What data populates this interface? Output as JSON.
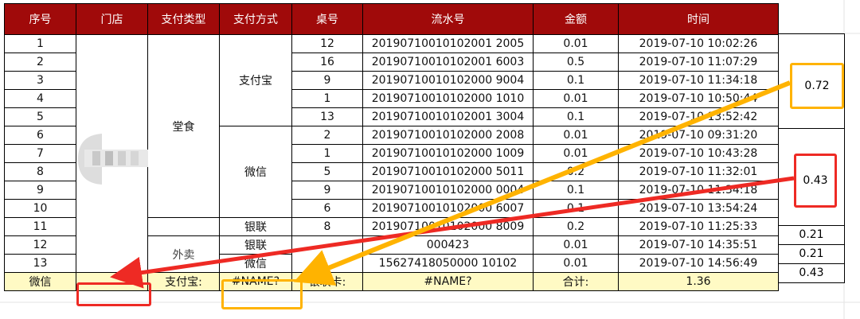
{
  "headers": [
    "序号",
    "门店",
    "支付类型",
    "支付方式",
    "桌号",
    "流水号",
    "金额",
    "时间"
  ],
  "seq": [
    "1",
    "2",
    "3",
    "4",
    "5",
    "6",
    "7",
    "8",
    "9",
    "10",
    "11",
    "12",
    "13"
  ],
  "pay_type": {
    "dine_in": "堂食",
    "takeaway_partial": "外卖"
  },
  "pay_method": {
    "alipay": "支付宝",
    "wechat": "微信",
    "unionpay": "银联",
    "unionpay2": "银联",
    "wechat2": "微信"
  },
  "rows": [
    {
      "table": "12",
      "serial": "20190710010102001 2005",
      "amount": "0.01",
      "time": "2019-07-10 10:02:26"
    },
    {
      "table": "16",
      "serial": "20190710010102001 6003",
      "amount": "0.5",
      "time": "2019-07-10 11:07:29"
    },
    {
      "table": "9",
      "serial": "20190710010102000 9004",
      "amount": "0.1",
      "time": "2019-07-10 11:34:18"
    },
    {
      "table": "1",
      "serial": "20190710010102000 1010",
      "amount": "0.01",
      "time": "2019-07-10 10:50:44"
    },
    {
      "table": "13",
      "serial": "20190710010102001 3004",
      "amount": "0.1",
      "time": "2019-07-10 13:52:42"
    },
    {
      "table": "2",
      "serial": "20190710010102000 2008",
      "amount": "0.01",
      "time": "2019-07-10 09:31:20"
    },
    {
      "table": "1",
      "serial": "20190710010102000 1009",
      "amount": "0.01",
      "time": "2019-07-10 10:43:28"
    },
    {
      "table": "5",
      "serial": "20190710010102000 5011",
      "amount": "0.2",
      "time": "2019-07-10 11:32:01"
    },
    {
      "table": "9",
      "serial": "20190710010102000 0004",
      "amount": "0.1",
      "time": "2019-07-10 11:34:18"
    },
    {
      "table": "6",
      "serial": "20190710010102000 6007",
      "amount": "0.1",
      "time": "2019-07-10 13:54:24"
    },
    {
      "table": "8",
      "serial": "20190710010102000 8009",
      "amount": "0.2",
      "time": "2019-07-10 11:25:33"
    },
    {
      "table": "",
      "serial": "000423",
      "amount": "0.01",
      "time": "2019-07-10 14:35:51"
    },
    {
      "table": "",
      "serial": "15627418050000 10102",
      "amount": "0.01",
      "time": "2019-07-10 14:56:49"
    }
  ],
  "side": {
    "alipay_total": "0.72",
    "wechat_total": "0.43",
    "row11": "0.21",
    "row12": "0.21",
    "row13": "0.43"
  },
  "summary": {
    "wechat_label": "微信",
    "alipay_label": "支付宝:",
    "alipay_value": "#NAME?",
    "union_label": "银联卡:",
    "union_value": "#NAME?",
    "total_label": "合计:",
    "total_value": "1.36"
  },
  "colors": {
    "header_bg": "#a00a0a",
    "summary_bg": "#fffac4",
    "orange": "#ffb300",
    "red": "#ee2a24"
  }
}
